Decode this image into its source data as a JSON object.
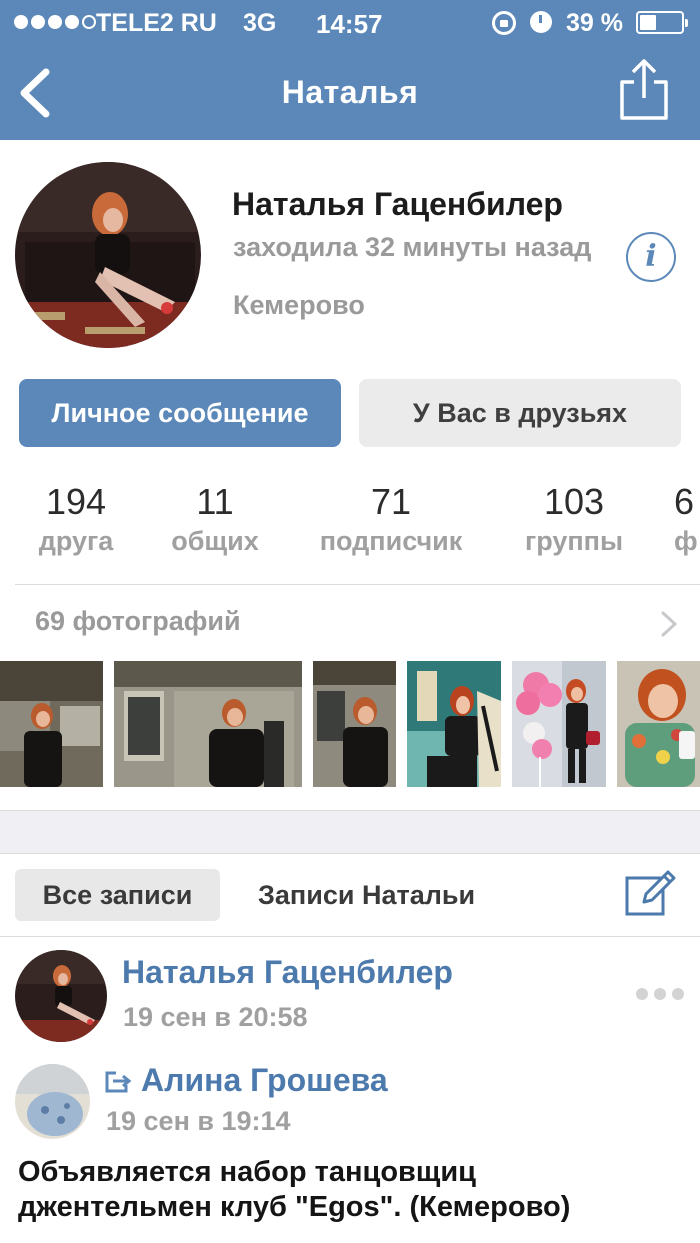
{
  "status_bar": {
    "signal_dots": 5,
    "carrier": "TELE2 RU",
    "network": "3G",
    "time": "14:57",
    "battery_percent_label": "39 %",
    "battery_level": 0.39,
    "icons": [
      "orientation-lock-icon",
      "alarm-icon",
      "battery-icon"
    ]
  },
  "nav": {
    "title": "Наталья",
    "back_icon": "chevron-left-icon",
    "share_icon": "share-icon"
  },
  "profile": {
    "name": "Наталья Гаценбилер",
    "last_seen": "заходила 32 минуты назад",
    "city": "Кемерово",
    "info_icon_glyph": "i"
  },
  "actions": {
    "message_button": "Личное сообщение",
    "friends_button": "У Вас в друзьях"
  },
  "counters": [
    {
      "value": "194",
      "label": "друга"
    },
    {
      "value": "11",
      "label": "общих"
    },
    {
      "value": "71",
      "label": "подписчик"
    },
    {
      "value": "103",
      "label": "группы"
    },
    {
      "value": "6",
      "label": "ф"
    }
  ],
  "photos": {
    "label": "69 фотографий",
    "thumbnail_count": 6
  },
  "wall": {
    "tab_all": "Все записи",
    "tab_own": "Записи Натальи",
    "compose_icon": "compose-icon"
  },
  "post": {
    "author": "Наталья Гаценбилер",
    "time": "19 сен в 20:58",
    "repost_author": "Алина Грошева",
    "repost_time": "19 сен в 19:14",
    "text": "Объявляется набор танцовщиц\nджентельмен клуб \"Egos\". (Кемерово)"
  },
  "colors": {
    "brand_blue": "#5b88b8",
    "link_blue": "#4d7aad",
    "muted_gray": "#9a9a9a"
  }
}
